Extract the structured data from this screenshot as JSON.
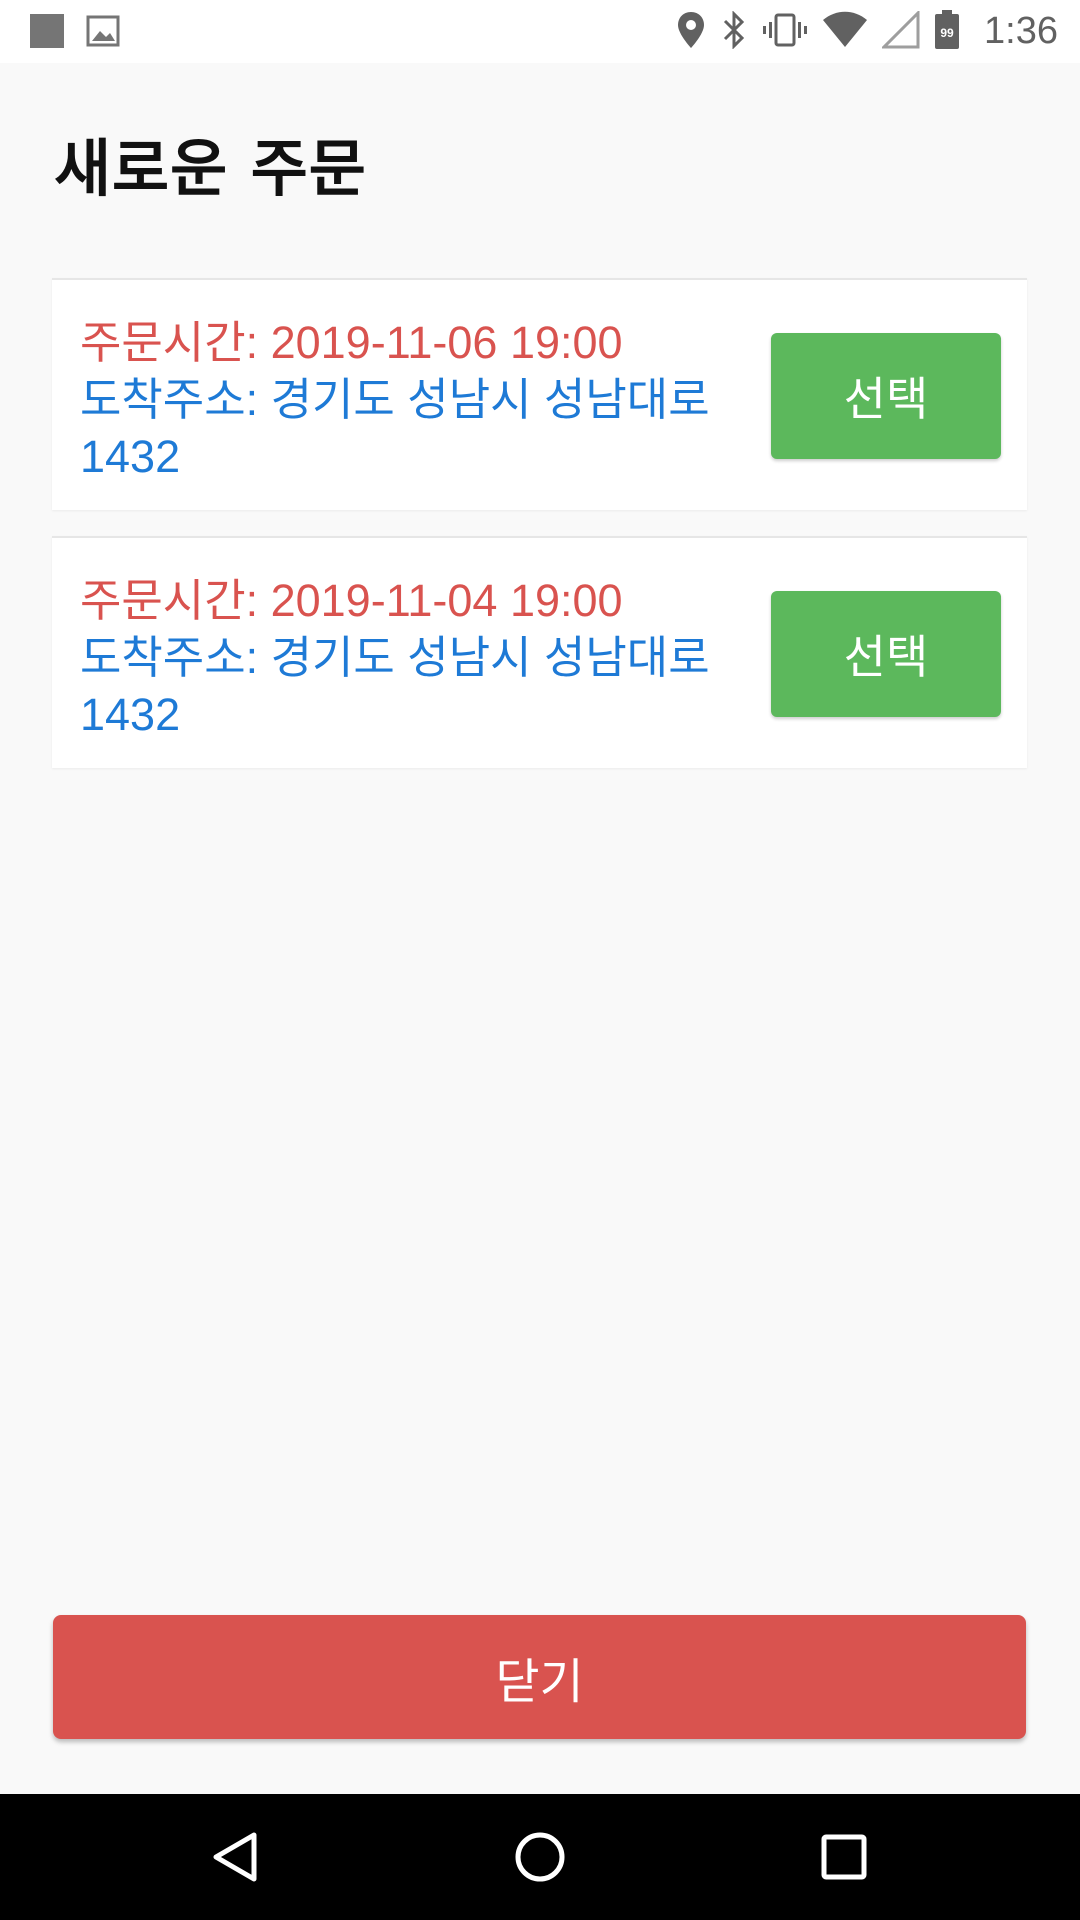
{
  "status_bar": {
    "time": "1:36",
    "battery_level": "99",
    "icons_left": [
      "notification-square-icon",
      "image-icon"
    ],
    "icons_right": [
      "location-icon",
      "bluetooth-icon",
      "vibrate-icon",
      "wifi-icon",
      "cell-signal-icon",
      "battery-icon"
    ]
  },
  "page": {
    "title": "새로운 주문"
  },
  "orders": [
    {
      "time_label": "주문시간: 2019-11-06 19:00",
      "address_line1": "도착주소: 경기도 성남시 성남대로",
      "address_line2": "1432",
      "select_label": "선택"
    },
    {
      "time_label": "주문시간: 2019-11-04 19:00",
      "address_line1": "도착주소: 경기도 성남시 성남대로",
      "address_line2": "1432",
      "select_label": "선택"
    }
  ],
  "footer": {
    "close_label": "닫기"
  },
  "colors": {
    "time_text": "#d9534f",
    "address_text": "#1e7ad6",
    "select_button": "#5cb85c",
    "close_button": "#d9534f"
  },
  "nav_bar": {
    "icons": [
      "back-icon",
      "home-icon",
      "recents-icon"
    ]
  }
}
